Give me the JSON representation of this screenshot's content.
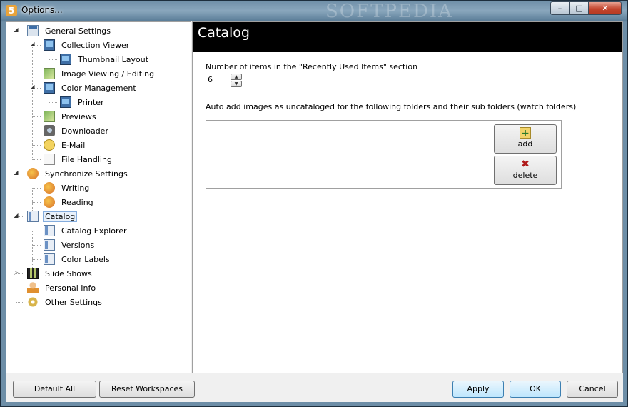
{
  "window": {
    "title": "Options...",
    "app_icon_glyph": "5",
    "watermark": "SOFTPEDIA",
    "controls": {
      "minimize": "–",
      "maximize": "□",
      "close": "✕"
    }
  },
  "tree": {
    "items": [
      {
        "label": "General Settings",
        "icon": "window-icon"
      },
      {
        "label": "Collection Viewer",
        "icon": "monitor-icon"
      },
      {
        "label": "Thumbnail Layout",
        "icon": "monitor-icon"
      },
      {
        "label": "Image Viewing / Editing",
        "icon": "image-icon"
      },
      {
        "label": "Color Management",
        "icon": "monitor-icon"
      },
      {
        "label": "Printer",
        "icon": "monitor-icon"
      },
      {
        "label": "Previews",
        "icon": "image-icon"
      },
      {
        "label": "Downloader",
        "icon": "camera-icon"
      },
      {
        "label": "E-Mail",
        "icon": "mail-icon"
      },
      {
        "label": "File Handling",
        "icon": "file-icon"
      },
      {
        "label": "Synchronize Settings",
        "icon": "sync-icon"
      },
      {
        "label": "Writing",
        "icon": "sync-icon"
      },
      {
        "label": "Reading",
        "icon": "sync-icon"
      },
      {
        "label": "Catalog",
        "icon": "catalog-icon",
        "selected": true
      },
      {
        "label": "Catalog Explorer",
        "icon": "catalog-icon"
      },
      {
        "label": "Versions",
        "icon": "catalog-icon"
      },
      {
        "label": "Color Labels",
        "icon": "catalog-icon"
      },
      {
        "label": "Slide Shows",
        "icon": "film-icon"
      },
      {
        "label": "Personal Info",
        "icon": "person-icon"
      },
      {
        "label": "Other Settings",
        "icon": "gear-icon"
      }
    ]
  },
  "panel": {
    "title": "Catalog",
    "recent_label": "Number of items in the \"Recently Used Items\" section",
    "recent_value": "6",
    "watch_label": "Auto add images as uncataloged for the following folders and their sub folders (watch folders)",
    "add_label": "add",
    "delete_label": "delete"
  },
  "footer": {
    "default_all": "Default All",
    "reset_workspaces": "Reset Workspaces",
    "apply": "Apply",
    "ok": "OK",
    "cancel": "Cancel"
  }
}
